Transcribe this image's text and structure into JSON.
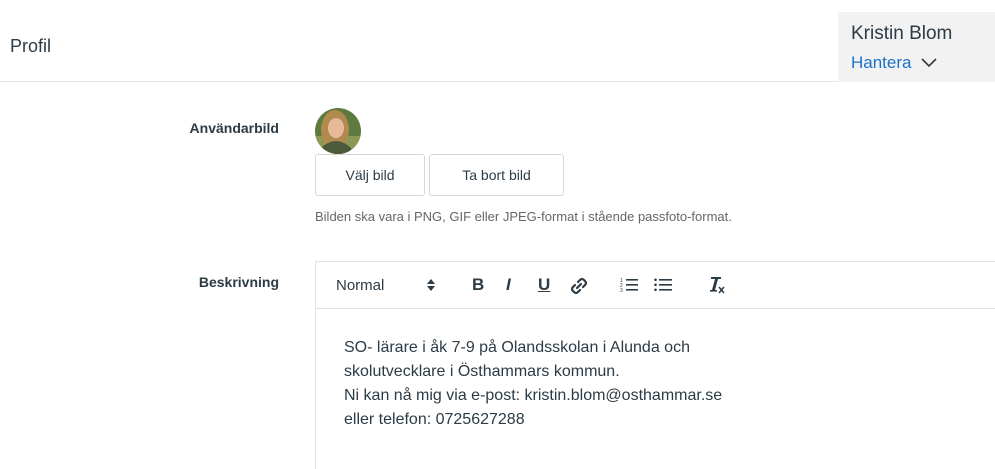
{
  "header": {
    "title": "Profil",
    "user_name": "Kristin Blom",
    "manage_label": "Hantera"
  },
  "avatar_section": {
    "label": "Användarbild",
    "choose_button": "Välj bild",
    "remove_button": "Ta bort bild",
    "hint": "Bilden ska vara i PNG, GIF eller JPEG-format i stående passfoto-format."
  },
  "description": {
    "label": "Beskrivning",
    "toolbar": {
      "format_select": "Normal",
      "bold": "B",
      "italic": "I",
      "underline": "U"
    },
    "lines": [
      "SO- lärare i åk 7-9 på Olandsskolan i Alunda och",
      "skolutvecklare i Östhammars kommun.",
      "Ni kan nå mig via e-post: kristin.blom@osthammar.se",
      "eller telefon: 0725627288"
    ]
  },
  "colors": {
    "link": "#1a73c8",
    "text": "#2d3b45",
    "panel": "#f2f2f2"
  }
}
